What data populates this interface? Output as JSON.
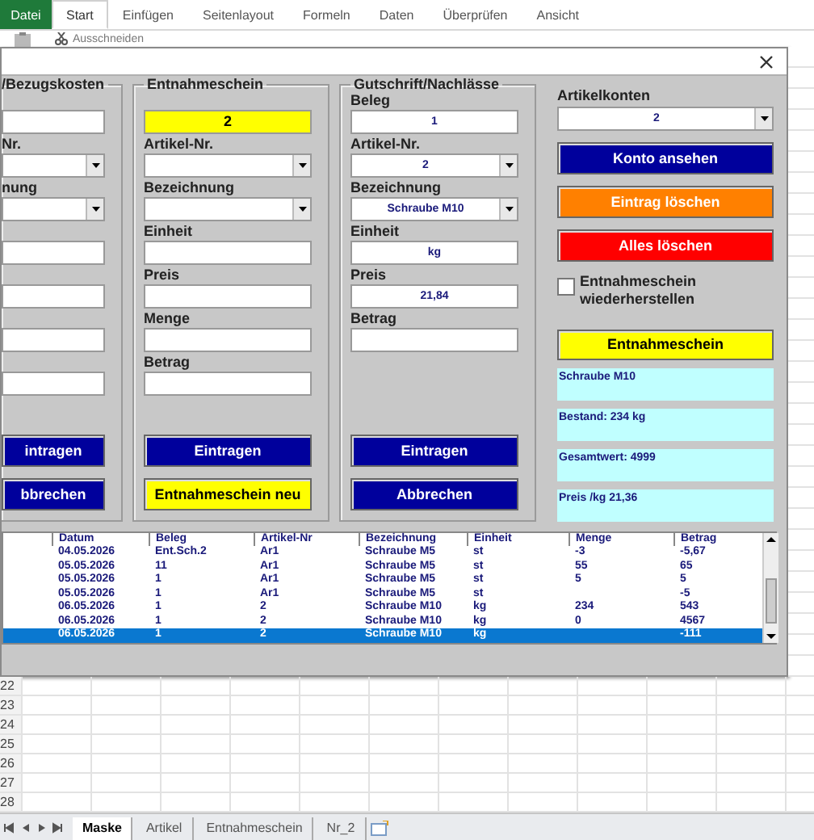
{
  "ribbon": {
    "file_tab": "Datei",
    "tabs": [
      {
        "label": "Start",
        "selected": true
      },
      {
        "label": "Einfügen",
        "selected": false
      },
      {
        "label": "Seitenlayout",
        "selected": false
      },
      {
        "label": "Formeln",
        "selected": false
      },
      {
        "label": "Daten",
        "selected": false
      },
      {
        "label": "Überprüfen",
        "selected": false
      },
      {
        "label": "Ansicht",
        "selected": false
      }
    ],
    "tool": "Ausschneiden"
  },
  "dialog": {
    "frames": [
      {
        "title": "/Bezugskosten",
        "rows": [
          {
            "kind": "text"
          },
          {
            "kind": "combo",
            "label": "Nr."
          },
          {
            "kind": "combo",
            "label": "nung"
          },
          {
            "kind": "text"
          },
          {
            "kind": "text"
          },
          {
            "kind": "text"
          },
          {
            "kind": "text"
          }
        ],
        "buttons": [
          {
            "label": "intragen",
            "color": "#00009c"
          },
          {
            "label": "bbrechen",
            "color": "#00009c"
          }
        ]
      },
      {
        "title": "Entnahmeschein",
        "rows": [
          {
            "kind": "header",
            "value": "2"
          },
          {
            "kind": "combo",
            "label": "Artikel-Nr."
          },
          {
            "kind": "combo",
            "label": "Bezeichnung"
          },
          {
            "kind": "text",
            "label": "Einheit"
          },
          {
            "kind": "text",
            "label": "Preis"
          },
          {
            "kind": "text",
            "label": "Menge"
          },
          {
            "kind": "text",
            "label": "Betrag"
          }
        ],
        "buttons": [
          {
            "label": "Eintragen",
            "color": "#00009c"
          },
          {
            "label": "Entnahmeschein neu",
            "color": "#ffff00"
          }
        ]
      },
      {
        "title": "Gutschrift/Nachlässe",
        "rows": [
          {
            "kind": "text",
            "label": "Beleg",
            "value": "1"
          },
          {
            "kind": "combo",
            "label": "Artikel-Nr.",
            "value": "2"
          },
          {
            "kind": "combo",
            "label": "Bezeichnung",
            "value": "Schraube M10"
          },
          {
            "kind": "text",
            "label": "Einheit",
            "value": "kg"
          },
          {
            "kind": "text",
            "label": "Preis",
            "value": "21,84"
          },
          {
            "kind": "text",
            "label": "Betrag"
          }
        ],
        "buttons": [
          {
            "label": "Eintragen",
            "color": "#00009c"
          },
          {
            "label": "Abbrechen",
            "color": "#00009c"
          }
        ]
      }
    ],
    "side": [
      {
        "kind": "label",
        "text": "Artikelkonten"
      },
      {
        "kind": "combo",
        "value": "2"
      },
      {
        "kind": "button",
        "text": "Konto ansehen",
        "color": "#00009c"
      },
      {
        "kind": "button",
        "text": "Eintrag löschen",
        "color": "#ff8000"
      },
      {
        "kind": "button",
        "text": "Alles löschen",
        "color": "#ff0000"
      },
      {
        "kind": "checkbox",
        "text": "Entnahmeschein wiederherstellen",
        "checked": false
      },
      {
        "kind": "button",
        "text": "Entnahmeschein",
        "color": "#ffff00"
      },
      {
        "kind": "info",
        "text": "Schraube M10"
      },
      {
        "kind": "info",
        "text": "Bestand: 234 kg"
      },
      {
        "kind": "info",
        "text": "Gesamtwert: 4999"
      },
      {
        "kind": "info",
        "text": "Preis /kg 21,36"
      }
    ],
    "list": {
      "columns": [
        "Datum",
        "Beleg",
        "Artikel-Nr",
        "Bezeichnung",
        "Einheit",
        "Menge",
        "Betrag"
      ],
      "rows": [
        {
          "cells": [
            "04.05.2026",
            "Ent.Sch.2",
            "Ar1",
            "Schraube M5",
            "st",
            "-3",
            "-5,67"
          ],
          "selected": false
        },
        {
          "cells": [
            "05.05.2026",
            "11",
            "Ar1",
            "Schraube M5",
            "st",
            "55",
            "65"
          ],
          "selected": false
        },
        {
          "cells": [
            "05.05.2026",
            "1",
            "Ar1",
            "Schraube M5",
            "st",
            "5",
            "5"
          ],
          "selected": false
        },
        {
          "cells": [
            "05.05.2026",
            "1",
            "Ar1",
            "Schraube M5",
            "st",
            "",
            "-5"
          ],
          "selected": false
        },
        {
          "cells": [
            "06.05.2026",
            "1",
            "2",
            "Schraube M10",
            "kg",
            "234",
            "543"
          ],
          "selected": false
        },
        {
          "cells": [
            "06.05.2026",
            "1",
            "2",
            "Schraube M10",
            "kg",
            "0",
            "4567"
          ],
          "selected": false
        },
        {
          "cells": [
            "06.05.2026",
            "1",
            "2",
            "Schraube M10",
            "kg",
            "",
            "-111"
          ],
          "selected": true
        }
      ]
    }
  },
  "sheet": {
    "row_numbers": [
      "22",
      "23",
      "24",
      "25",
      "26",
      "27",
      "28"
    ]
  },
  "sheet_tabs": [
    {
      "label": "Maske",
      "selected": true
    },
    {
      "label": "Artikel",
      "selected": false
    },
    {
      "label": "Entnahmeschein",
      "selected": false
    },
    {
      "label": "Nr_2",
      "selected": false
    }
  ]
}
